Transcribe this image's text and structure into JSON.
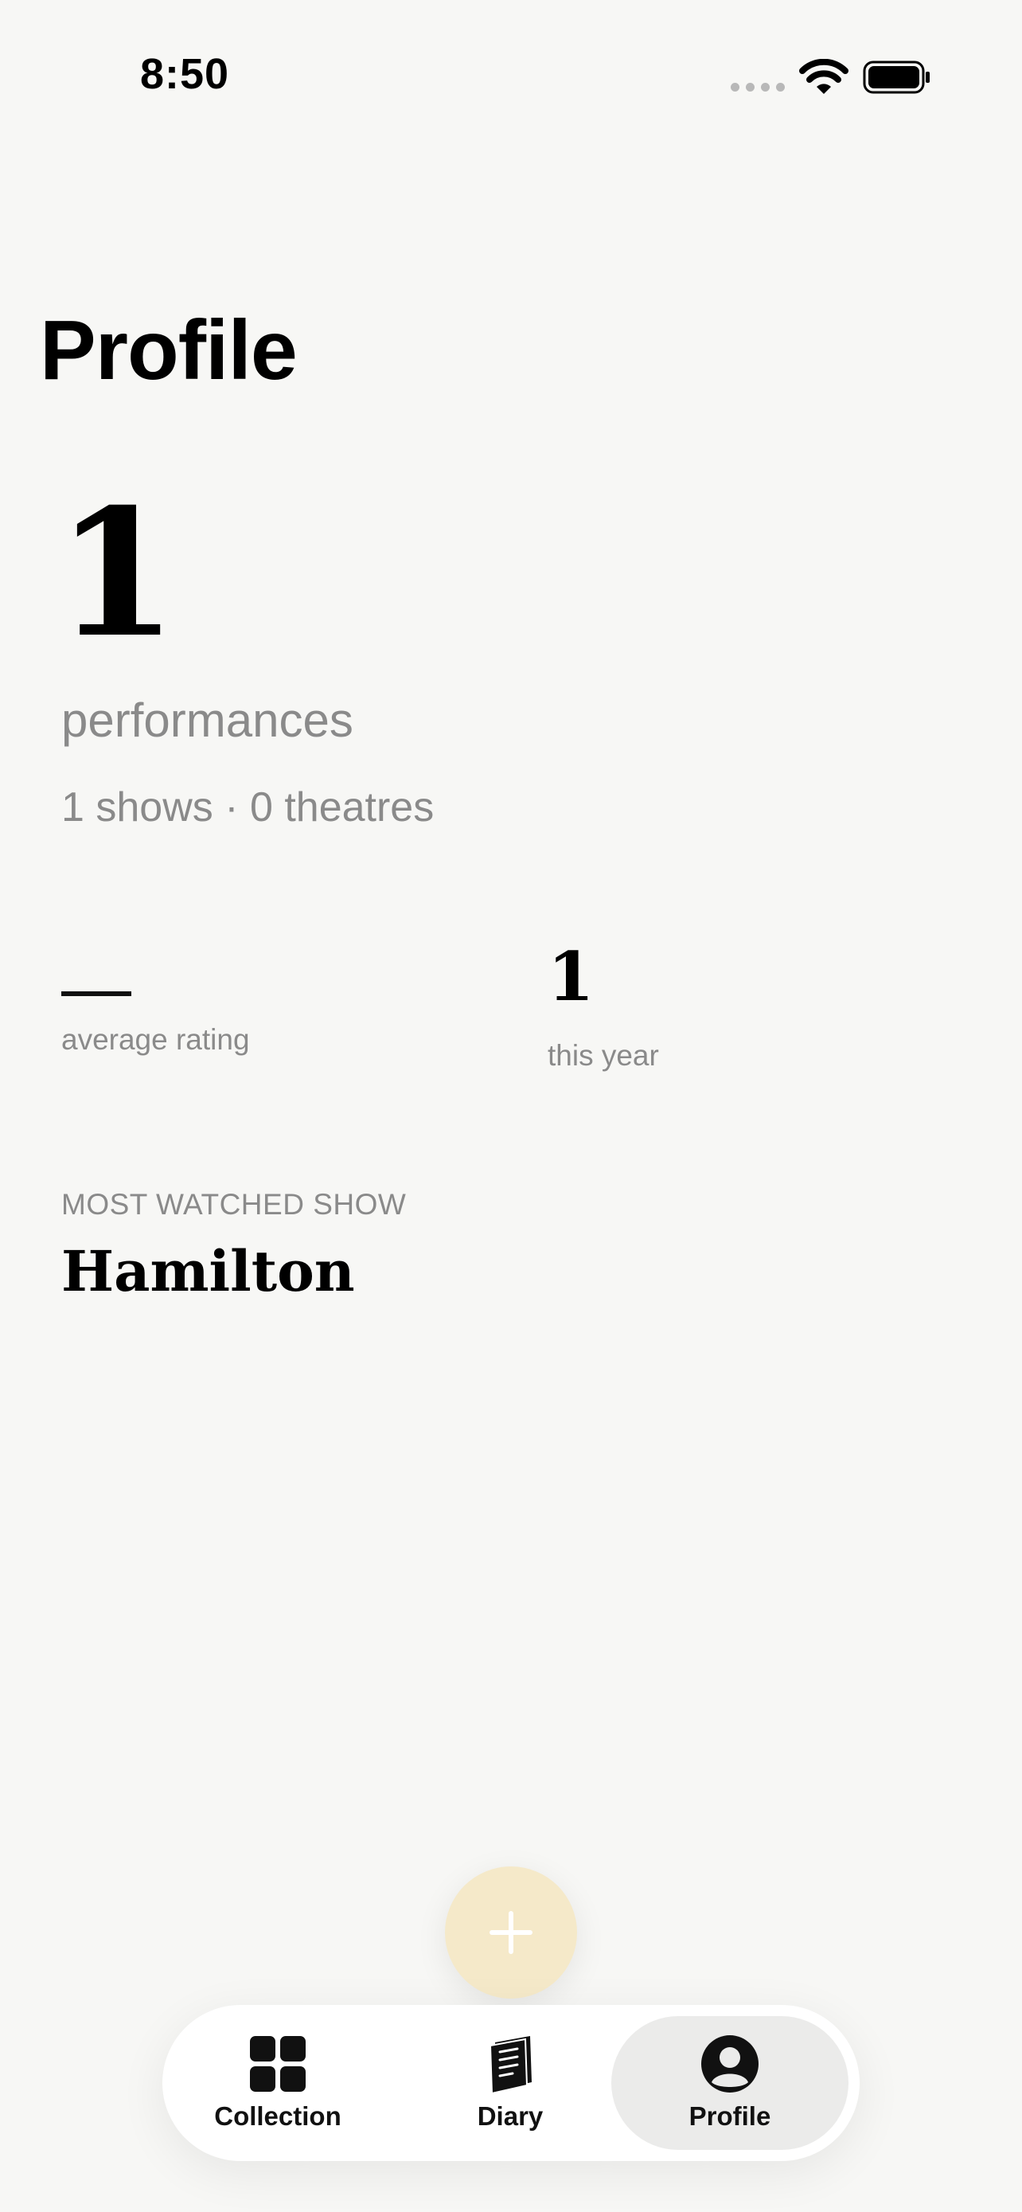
{
  "status_bar": {
    "time": "8:50"
  },
  "page": {
    "title": "Profile"
  },
  "stats": {
    "performances_count": "1",
    "performances_label": "performances",
    "summary": "1 shows · 0 theatres",
    "average_rating_value": "—",
    "average_rating_label": "average rating",
    "this_year_value": "1",
    "this_year_label": "this year"
  },
  "most_watched": {
    "label": "MOST WATCHED SHOW",
    "show": "Hamilton"
  },
  "fab": {
    "icon": "plus-icon",
    "color": "#f5e9c9"
  },
  "tab_bar": {
    "tabs": [
      {
        "label": "Collection",
        "icon": "grid-icon",
        "active": false
      },
      {
        "label": "Diary",
        "icon": "book-icon",
        "active": false
      },
      {
        "label": "Profile",
        "icon": "person-circle-icon",
        "active": true
      }
    ]
  },
  "colors": {
    "background": "#f7f7f5",
    "muted_text": "#8a8a8a",
    "active_tab": "#ebebea"
  }
}
